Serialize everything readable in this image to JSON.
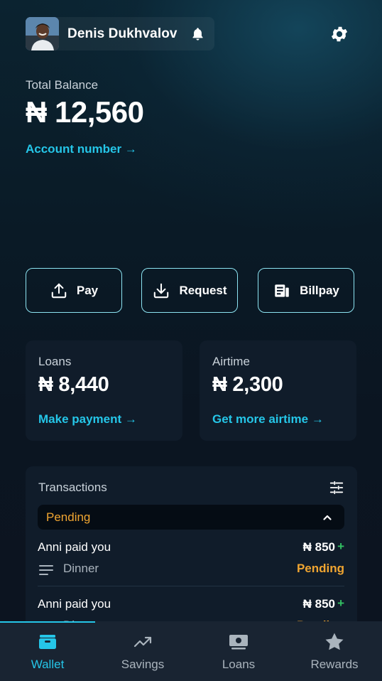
{
  "header": {
    "user_name": "Denis Dukhvalov"
  },
  "balance": {
    "label": "Total Balance",
    "value": "₦ 12,560",
    "account_link": "Account number →"
  },
  "actions": [
    {
      "label": "Pay",
      "icon": "upload-icon"
    },
    {
      "label": "Request",
      "icon": "download-icon"
    },
    {
      "label": "Billpay",
      "icon": "bill-icon"
    }
  ],
  "cards": {
    "loans": {
      "label": "Loans",
      "value": "₦ 8,440",
      "link": "Make payment →"
    },
    "airtime": {
      "label": "Airtime",
      "value": "₦ 2,300",
      "link": "Get more airtime →"
    }
  },
  "transactions": {
    "title": "Transactions",
    "filter_selected": "Pending",
    "rows": [
      {
        "desc": "Anni paid you",
        "amount": "₦ 850",
        "sign": "+",
        "note": "Dinner",
        "status": "Pending"
      },
      {
        "desc": "Anni paid you",
        "amount": "₦ 850",
        "sign": "+",
        "note": "Dinner",
        "status": "Pending"
      }
    ]
  },
  "nav": {
    "items": [
      {
        "label": "Wallet",
        "icon": "wallet-icon",
        "active": true
      },
      {
        "label": "Savings",
        "icon": "trending-up-icon",
        "active": false
      },
      {
        "label": "Loans",
        "icon": "cash-icon",
        "active": false
      },
      {
        "label": "Rewards",
        "icon": "star-icon",
        "active": false
      }
    ]
  },
  "colors": {
    "accent": "#25c6e8",
    "pending": "#f0a531",
    "positive": "#33c163",
    "card_bg": "#101c2a",
    "nav_bg": "#192432"
  }
}
